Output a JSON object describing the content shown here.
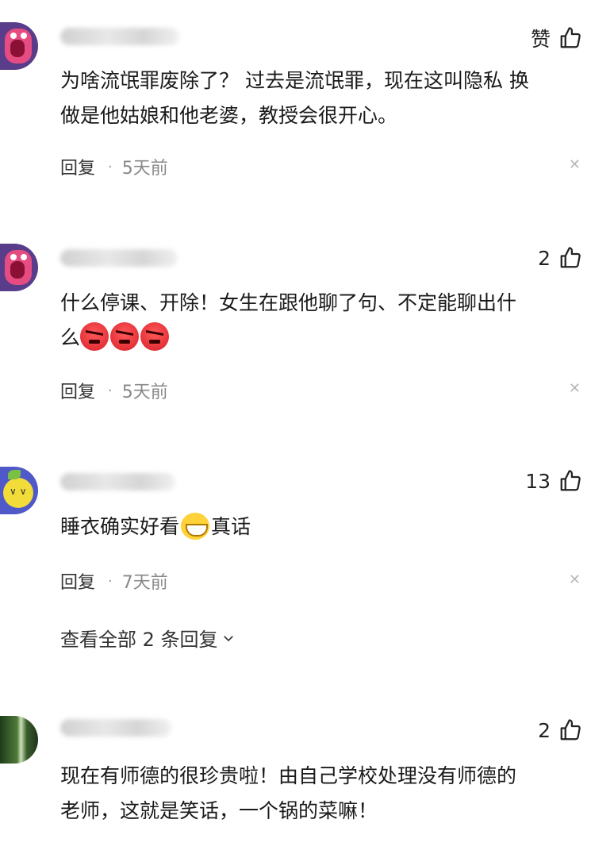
{
  "comments": [
    {
      "likes": "赞",
      "text_line1": "为啥流氓罪废除了？ 过去是流氓罪，现在这叫隐私 换",
      "text_line2": "做是他姑娘和他老婆，教授会很开心。",
      "reply_label": "回复",
      "time": "5天前",
      "avatar": "pink-monster-avatar"
    },
    {
      "likes": "2",
      "text_line1": "什么停课、开除！女生在跟他聊了句、不定能聊出什",
      "text_line2": "么",
      "emojis": [
        "angry-emoji",
        "angry-emoji",
        "angry-emoji"
      ],
      "reply_label": "回复",
      "time": "5天前",
      "avatar": "pink-monster-avatar"
    },
    {
      "likes": "13",
      "text_before": "睡衣确实好看",
      "text_after": "真话",
      "emoji": "grin-emoji",
      "reply_label": "回复",
      "time": "7天前",
      "view_all": "查看全部 2 条回复",
      "avatar": "lemon-avatar"
    },
    {
      "likes": "2",
      "text_line1": "现在有师德的很珍贵啦！由自己学校处理没有师德的",
      "text_line2": "老师，这就是笑话，一个锅的菜嘛！",
      "avatar": "forest-avatar"
    }
  ],
  "colors": {
    "text": "#1a1a1a",
    "time": "#888888",
    "close": "#b8b8b8"
  }
}
